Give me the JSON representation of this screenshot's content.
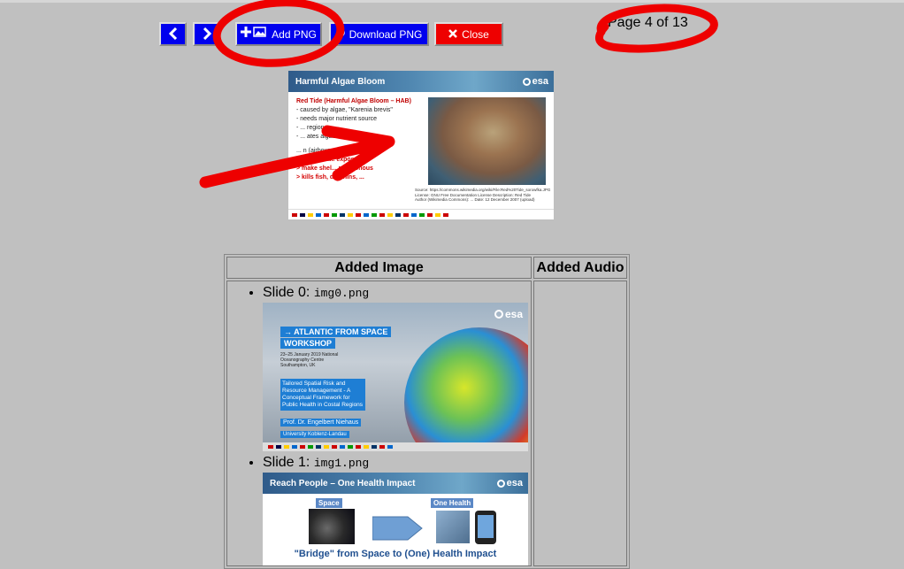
{
  "toolbar": {
    "prev_glyph": "<",
    "next_glyph": ">",
    "add_png_label": "Add PNG",
    "download_png_label": "Download PNG",
    "close_label": "Close",
    "colors": {
      "blue": "#0000ee",
      "red": "#ee0000"
    }
  },
  "page_indicator": "Page 4 of 13",
  "preview": {
    "title": "Harmful Algae Bloom",
    "logo": "esa",
    "lines": [
      "Red Tide (Harmful Algae Bloom – HAB)",
      "- caused by algae, \"Karenia brevis\"",
      "- needs major nutrient source",
      "- ... region",
      "- ... ates algae",
      "... n (airbourne toxin)",
      "> skin irrita... exposure)",
      "> make shel... poissonous",
      "> kills fish, dolphins, ..."
    ],
    "source_lines": [
      "Source: https://commons.wikimedia.org/wiki/File:Red%20Tide_sorowfka.JPG",
      "License: GNU Free Documentation License  Description: Red Tide",
      "Author (Wikimedia Commons): ...  Date: 12 December 2007 (upload)"
    ],
    "photo_icon": "red-tide-photo"
  },
  "table": {
    "headers": {
      "image": "Added Image",
      "audio": "Added Audio"
    },
    "slides": [
      {
        "prefix": "Slide 0: ",
        "filename": "img0.png",
        "thumb": {
          "logo": "esa",
          "badge1": "→ ATLANTIC FROM SPACE",
          "badge2": "WORKSHOP",
          "dates": "23–25 January 2019 National Oceanography Centre Southampton, UK",
          "desc": "Tailored Spatial Risk and Resource Management - A Conceptual Framework for Public Health in Costal Regions",
          "prof": "Prof. Dr. Engelbert Niehaus",
          "uni": "University Koblenz-Landau"
        }
      },
      {
        "prefix": "Slide 1: ",
        "filename": "img1.png",
        "thumb": {
          "title": "Reach People – One Health Impact",
          "logo": "esa",
          "label_space": "Space",
          "label_health": "One Health",
          "bridge": "\"Bridge\" from Space to (One) Health Impact"
        }
      }
    ]
  },
  "annotations": {
    "color": "#ee0000"
  }
}
